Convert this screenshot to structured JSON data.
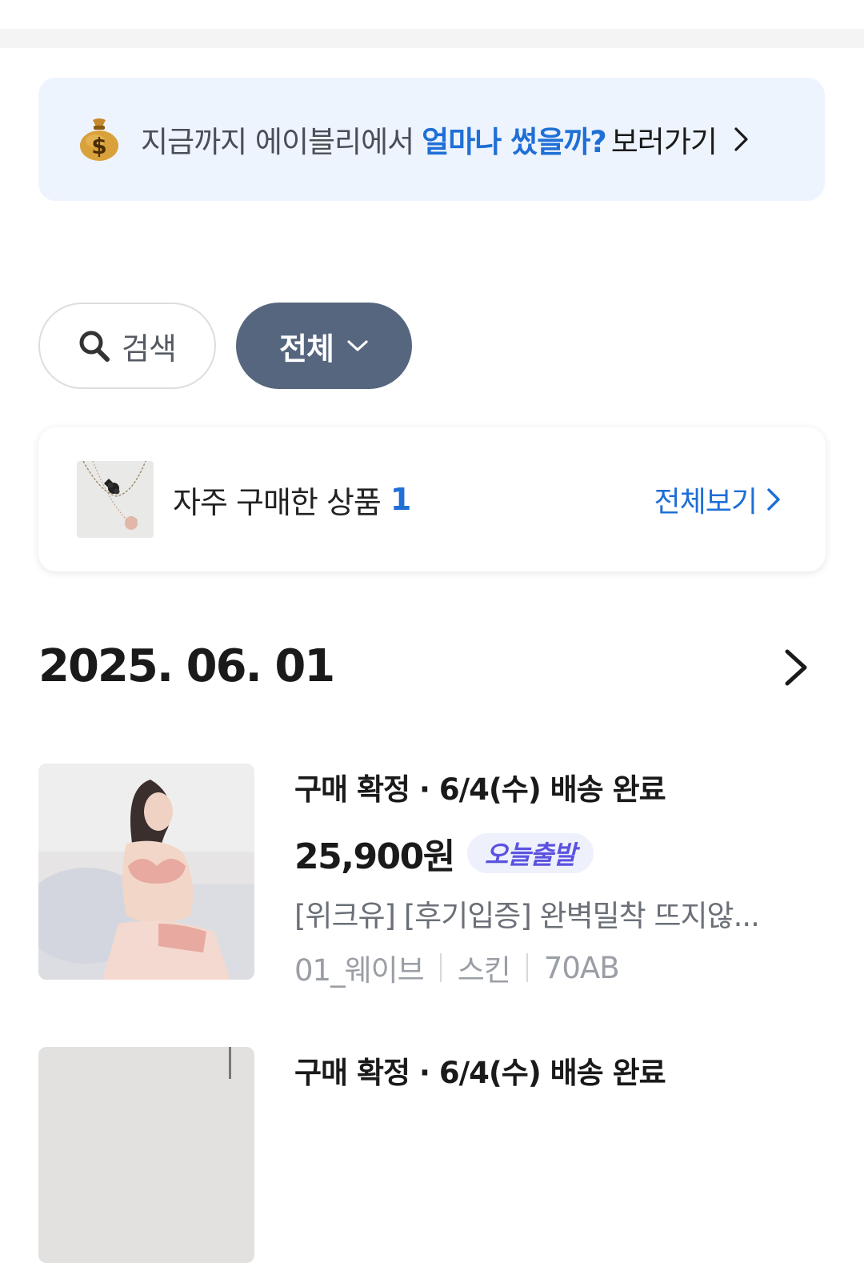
{
  "spend_banner": {
    "prefix": "지금까지 에이블리에서",
    "highlight": "얼마나 썼을까?",
    "action": "보러가기"
  },
  "filters": {
    "search_label": "검색",
    "category_label": "전체"
  },
  "frequent": {
    "label": "자주 구매한 상품",
    "count": "1",
    "view_all": "전체보기"
  },
  "order_group": {
    "date": "2025. 06. 01",
    "items": [
      {
        "status": "구매 확정 · 6/4(수) 배송 완료",
        "price": "25,900원",
        "badge": "오늘출발",
        "name": "[위크유] [후기입증] 완벽밀착 뜨지않...",
        "options": [
          "01_웨이브",
          "스킨",
          "70AB"
        ]
      },
      {
        "status": "구매 확정 · 6/4(수) 배송 완료"
      }
    ]
  },
  "colors": {
    "accent_blue": "#1f6fd6",
    "banner_bg": "#eef4fd",
    "filter_active_bg": "#56667e",
    "badge_text": "#5b52e0"
  }
}
